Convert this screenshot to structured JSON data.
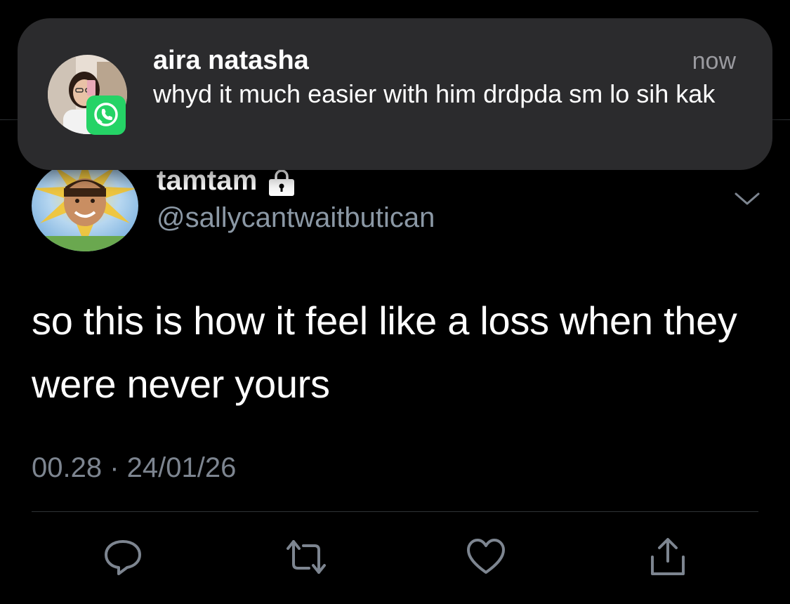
{
  "notification": {
    "app_icon": "whatsapp-icon",
    "sender": "aira natasha",
    "time": "now",
    "message": "whyd it much easier with him drdpda sm lo sih kak"
  },
  "tweet": {
    "display_name": "tamtam",
    "protected_icon": "lock-icon",
    "handle": "@sallycantwaitbutican",
    "text": "so this is how it feel like a loss when they were never yours",
    "timestamp": "00.28 · 24/01/26",
    "actions": [
      "reply-icon",
      "retweet-icon",
      "like-icon",
      "share-icon"
    ]
  },
  "colors": {
    "background": "#000000",
    "secondary_text": "#8b98a5",
    "banner": "#2b2b2d",
    "whatsapp_green": "#25d366"
  }
}
